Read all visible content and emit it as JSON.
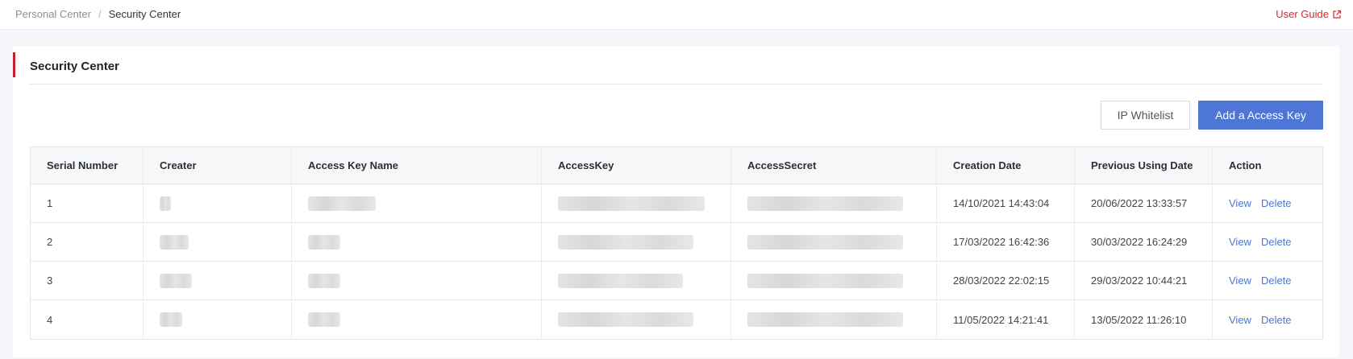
{
  "breadcrumb": {
    "parent": "Personal Center",
    "separator": "/",
    "current": "Security Center"
  },
  "user_guide": {
    "label": "User Guide",
    "icon": "external-link-icon"
  },
  "card": {
    "title": "Security Center"
  },
  "toolbar": {
    "ip_whitelist_label": "IP Whitelist",
    "add_key_label": "Add a Access Key"
  },
  "table": {
    "headers": [
      "Serial Number",
      "Creater",
      "Access Key Name",
      "AccessKey",
      "AccessSecret",
      "Creation Date",
      "Previous Using Date",
      "Action"
    ],
    "rows": [
      {
        "serial": "1",
        "creation_date": "14/10/2021 14:43:04",
        "previous_date": "20/06/2022 13:33:57",
        "view": "View",
        "delete": "Delete"
      },
      {
        "serial": "2",
        "creation_date": "17/03/2022 16:42:36",
        "previous_date": "30/03/2022 16:24:29",
        "view": "View",
        "delete": "Delete"
      },
      {
        "serial": "3",
        "creation_date": "28/03/2022 22:02:15",
        "previous_date": "29/03/2022 10:44:21",
        "view": "View",
        "delete": "Delete"
      },
      {
        "serial": "4",
        "creation_date": "11/05/2022 14:21:41",
        "previous_date": "13/05/2022 11:26:10",
        "view": "View",
        "delete": "Delete"
      }
    ]
  },
  "colors": {
    "accent_red": "#c8202e",
    "link_red": "#d9262f",
    "primary_blue": "#4d76d6"
  }
}
